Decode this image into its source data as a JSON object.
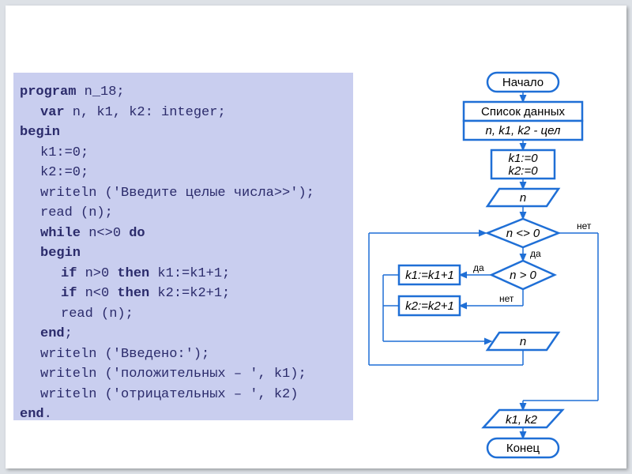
{
  "code": {
    "l1a": "program",
    "l1b": " n_18;",
    "l2a": "var",
    "l2b": " n, k1, k2: integer;",
    "l3": "begin",
    "l4": "k1:=0;",
    "l5": "k2:=0;",
    "l6": "writeln ('Введите целые числа>>');",
    "l7": "read (n);",
    "l8a": "while",
    "l8b": " n<>0 ",
    "l8c": "do",
    "l9": "begin",
    "l10a": "if",
    "l10b": " n>0 ",
    "l10c": "then",
    "l10d": " k1:=k1+1;",
    "l11a": "if",
    "l11b": " n<0 ",
    "l11c": "then",
    "l11d": " k2:=k2+1;",
    "l12": "read (n);",
    "l13a": "end",
    "l13b": ";",
    "l14": "writeln ('Введено:');",
    "l15": "writeln ('положительных – ', k1);",
    "l16": "writeln ('отрицательных – ', k2)",
    "l17a": "end",
    "l17b": "."
  },
  "flowchart": {
    "start": "Начало",
    "data_list": "Список данных",
    "data_vars": "n, k1, k2 - цел",
    "init1": "k1:=0",
    "init2": "k2:=0",
    "input_n": "n",
    "cond_outer": "n <> 0",
    "cond_inner": "n > 0",
    "assign_k1": "k1:=k1+1",
    "assign_k2": "k2:=k2+1",
    "read_n2": "n",
    "output": "k1, k2",
    "end": "Конец",
    "yes": "да",
    "no": "нет"
  }
}
